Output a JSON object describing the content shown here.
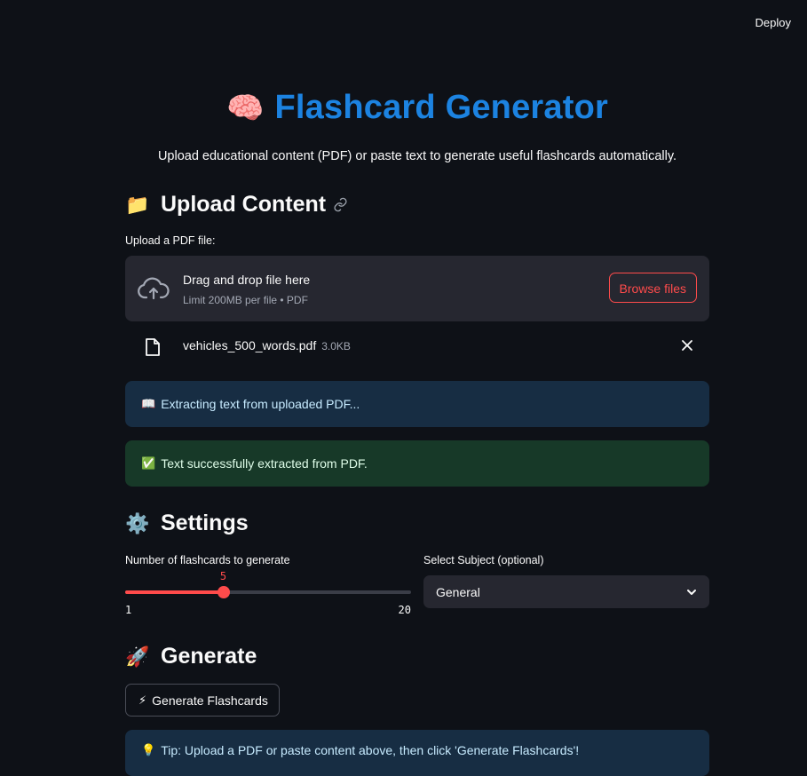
{
  "header": {
    "deploy_label": "Deploy"
  },
  "title": {
    "emoji": "🧠",
    "text": "Flashcard Generator"
  },
  "subtitle": "Upload educational content (PDF) or paste text to generate useful flashcards automatically.",
  "upload_section": {
    "emoji": "📁",
    "heading": "Upload Content",
    "uploader_label": "Upload a PDF file:",
    "dropzone_title": "Drag and drop file here",
    "dropzone_limit": "Limit 200MB per file • PDF",
    "browse_label": "Browse files",
    "file": {
      "name": "vehicles_500_words.pdf",
      "size": "3.0KB"
    }
  },
  "alerts": {
    "info": {
      "emoji": "📖",
      "text": "Extracting text from uploaded PDF..."
    },
    "success": {
      "emoji": "✅",
      "text": "Text successfully extracted from PDF."
    }
  },
  "settings": {
    "emoji": "⚙️",
    "heading": "Settings",
    "slider": {
      "label": "Number of flashcards to generate",
      "value": 5,
      "value_text": "5",
      "min": 1,
      "max": 20,
      "min_text": "1",
      "max_text": "20"
    },
    "subject": {
      "label": "Select Subject (optional)",
      "value": "General"
    }
  },
  "generate": {
    "emoji": "🚀",
    "heading": "Generate",
    "button_emoji": "⚡",
    "button_label": "Generate Flashcards"
  },
  "tip": {
    "emoji": "💡",
    "text": "Tip: Upload a PDF or paste content above, then click 'Generate Flashcards'!"
  },
  "colors": {
    "background": "#0e1117",
    "title": "#1c83e1",
    "accent": "#ff4b4b",
    "panel": "#262730",
    "info_bg": "#172d43",
    "success_bg": "#173928"
  }
}
